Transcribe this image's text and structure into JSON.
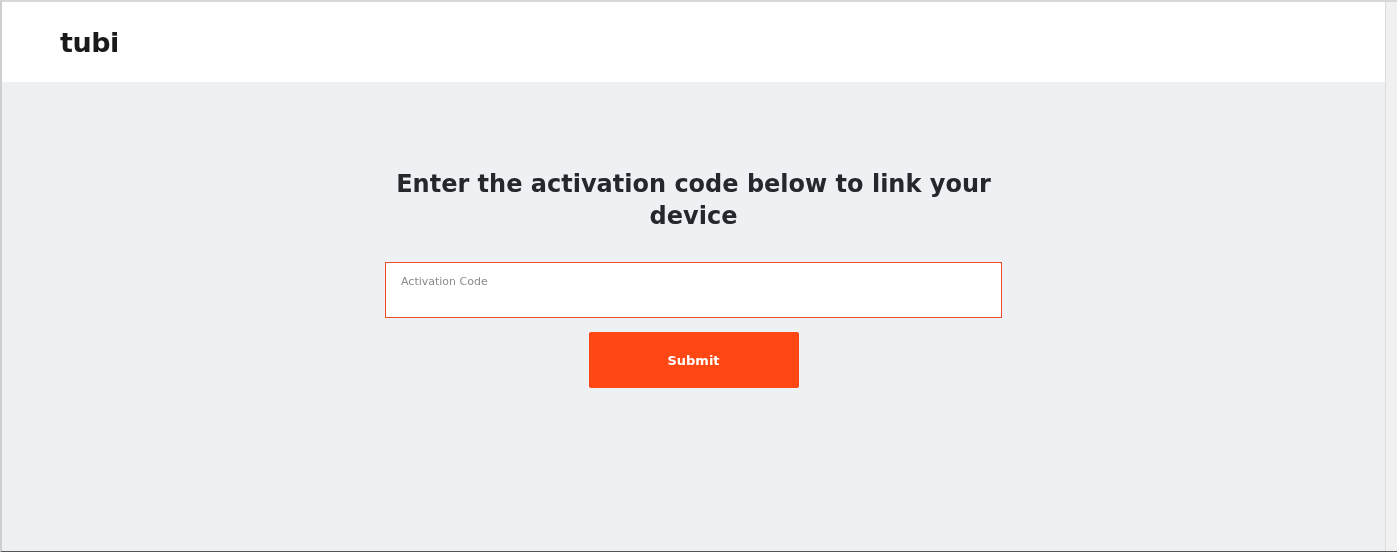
{
  "header": {
    "logo": "tubi"
  },
  "heading": "Enter the activation code below to link your device",
  "activation_field": {
    "placeholder": "Activation Code"
  },
  "submit_button": {
    "label": "Submit"
  }
}
